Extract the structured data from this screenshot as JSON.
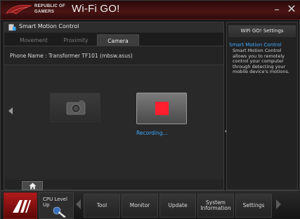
{
  "titlebar": {
    "brand_line1": "REPUBLIC OF",
    "brand_line2": "GAMERS",
    "title": "Wi-Fi GO!",
    "minimize_glyph": "–",
    "close_glyph": "✕"
  },
  "module": {
    "title": "Smart Motion Control",
    "icon": "smart-motion-icon"
  },
  "tabs": [
    {
      "label": "Movement",
      "active": false
    },
    {
      "label": "Proximity",
      "active": false
    },
    {
      "label": "Camera",
      "active": true
    }
  ],
  "phone": {
    "text": "Phone Name : Transformer TF101 (mbsw.asus)"
  },
  "camera": {
    "status": "Recording..."
  },
  "right_panel": {
    "settings_button": "WiFi GO! Settings",
    "help_title": "Smart Motion Control",
    "help_text": "Smart Motion Control allows you to remotely control your computer through detecting your mobile device's motions."
  },
  "bottombar": {
    "cpu_label_line1": "CPU Level",
    "cpu_label_line2": "Up",
    "nav": [
      {
        "label": "Tool"
      },
      {
        "label": "Monitor"
      },
      {
        "label": "Update"
      },
      {
        "label": "System Information"
      },
      {
        "label": "Settings"
      }
    ]
  },
  "colors": {
    "accent_blue": "#3aa7ff",
    "record_red": "#ff1e2d",
    "title_red": "#4b1414"
  }
}
